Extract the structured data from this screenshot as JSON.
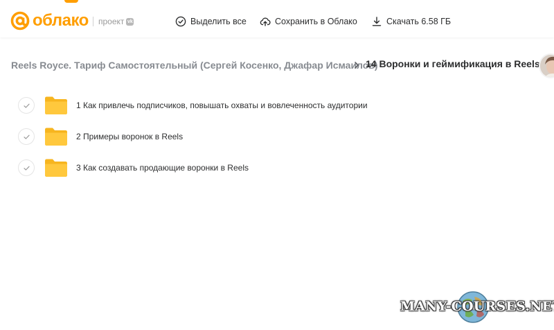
{
  "header": {
    "logo_text": "облако",
    "project_label": "проект",
    "project_badge": "vk",
    "brand_color": "#ff9e00",
    "actions": [
      {
        "label": "Выделить все",
        "icon": "check-circle-icon"
      },
      {
        "label": "Сохранить в Облако",
        "icon": "cloud-upload-icon"
      },
      {
        "label": "Скачать 6.58 ГБ",
        "icon": "download-icon"
      }
    ]
  },
  "breadcrumb": {
    "parent": "Reels Royce. Тариф Самостоятельный (Сергей Косенко, Джафар Исмаилов)",
    "current": "14 Воронки и геймификация в Reels"
  },
  "files": [
    {
      "name": "1 Как привлечь подписчиков, повышать охваты и вовлеченность аудитории",
      "type": "folder"
    },
    {
      "name": "2 Примеры воронок в Reels",
      "type": "folder"
    },
    {
      "name": "3 Как создавать продающие воронки в Reels",
      "type": "folder"
    }
  ],
  "watermark": {
    "text": "MANY-COURSES.NET"
  }
}
